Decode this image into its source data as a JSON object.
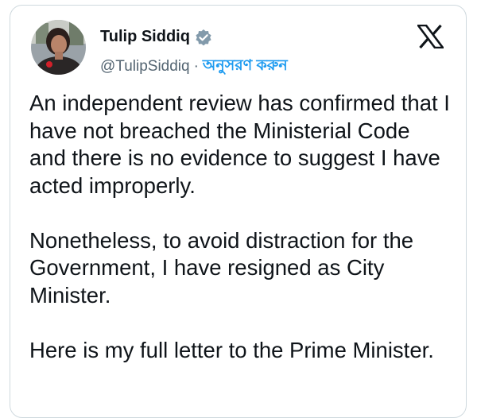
{
  "author": {
    "name": "Tulip Siddiq",
    "handle": "@TulipSiddiq",
    "separator": "·",
    "follow_label": "অনুসরণ করুন",
    "avatar_icon": "profile-photo",
    "verified_icon": "verified-badge-icon"
  },
  "platform_icon": "x-logo-icon",
  "tweet": {
    "paragraphs": [
      "An independent review has confirmed that I have not breached the Ministerial Code and there is no evidence to suggest I have acted improperly.",
      "Nonetheless, to avoid distraction for the Government, I have resigned as City Minister.",
      "Here is my full letter to the Prime Minister."
    ]
  },
  "colors": {
    "text": "#0f1419",
    "secondary": "#536471",
    "accent": "#1d9bf0",
    "border": "#cfd9de",
    "badge": "#829aab"
  }
}
